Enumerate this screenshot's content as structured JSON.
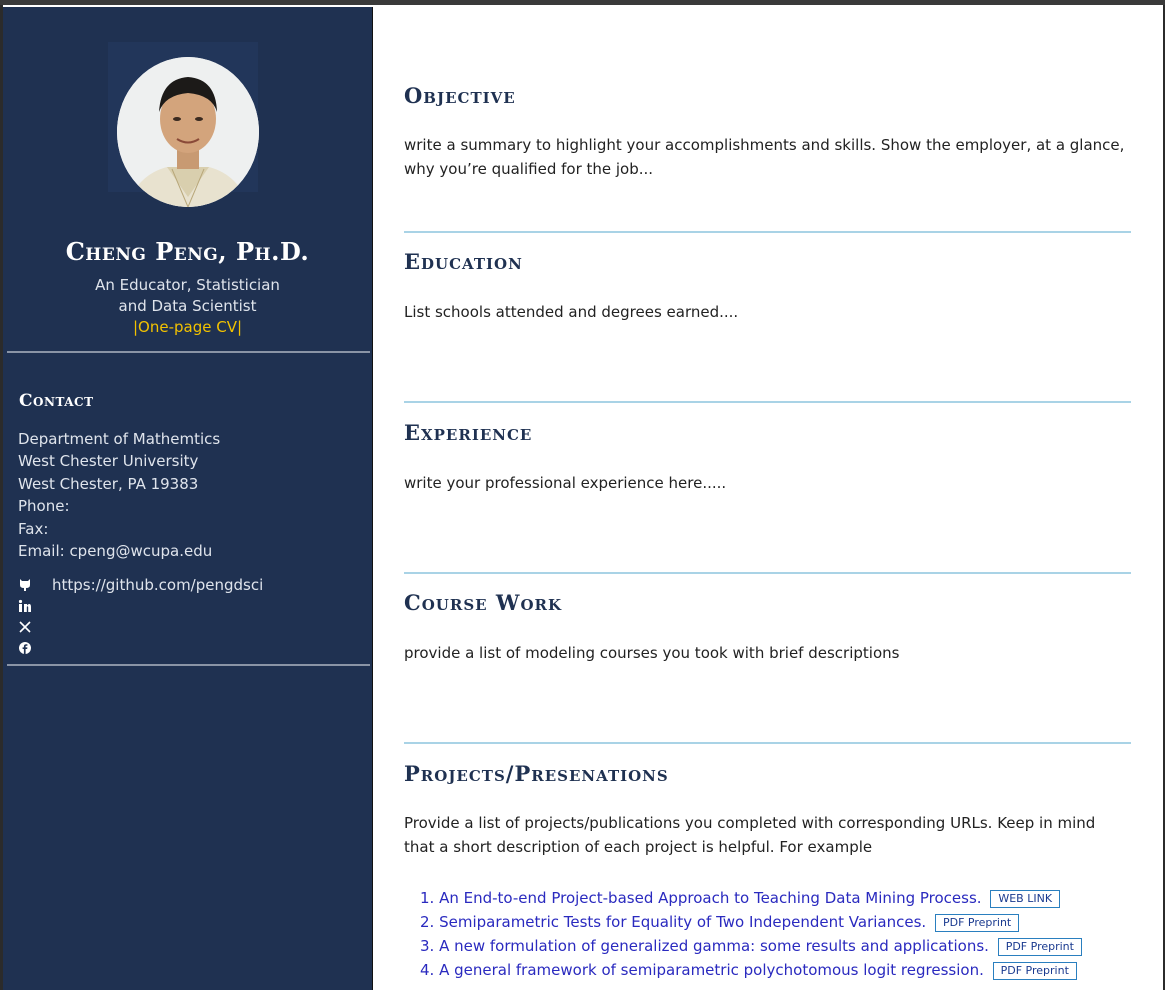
{
  "profile": {
    "name": "Cheng Peng, Ph.D.",
    "tagline_line1": "An Educator, Statistician",
    "tagline_line2": "and Data Scientist",
    "cv_link": "|One-page CV|"
  },
  "contact": {
    "title": "Contact",
    "lines": [
      "Department of Mathemtics",
      "West Chester University",
      "West Chester, PA 19383",
      "Phone:",
      "Fax:",
      "Email: cpeng@wcupa.edu"
    ],
    "github": "https://github.com/pengdsci",
    "icons": [
      "github-icon",
      "linkedin-icon",
      "x-icon",
      "facebook-icon"
    ]
  },
  "sections": {
    "objective": {
      "title": "Objective",
      "text": "write a summary to highlight your accomplishments and skills. Show the employer, at a glance, why you’re qualified for the job..."
    },
    "education": {
      "title": "Education",
      "text": "List schools attended and degrees earned...."
    },
    "experience": {
      "title": "Experience",
      "text": "write your professional experience here....."
    },
    "coursework": {
      "title": "Course Work",
      "text": "provide a list of modeling courses you took with brief descriptions"
    },
    "projects": {
      "title": "Projects/Presenations",
      "text": "Provide a list of projects/publications you completed with corresponding URLs. Keep in mind that a short description of each project is helpful. For example",
      "items": [
        {
          "num": "1.",
          "title": "An End-to-end Project-based Approach to Teaching Data Mining Process.",
          "badge": "WEB LINK"
        },
        {
          "num": "2.",
          "title": "Semiparametric Tests for Equality of Two Independent Variances.",
          "badge": "PDF Preprint"
        },
        {
          "num": "3.",
          "title": "A new formulation of generalized gamma: some results and applications.",
          "badge": "PDF Preprint"
        },
        {
          "num": "4.",
          "title": "A general framework of semiparametric polychotomous logit regression.",
          "badge": "PDF Preprint"
        }
      ]
    }
  },
  "colors": {
    "sidebar": "#1f3151",
    "accent_gold": "#f2c200",
    "heading": "#1f3151",
    "divider": "#a9d3e6",
    "link": "#2a2abf"
  }
}
